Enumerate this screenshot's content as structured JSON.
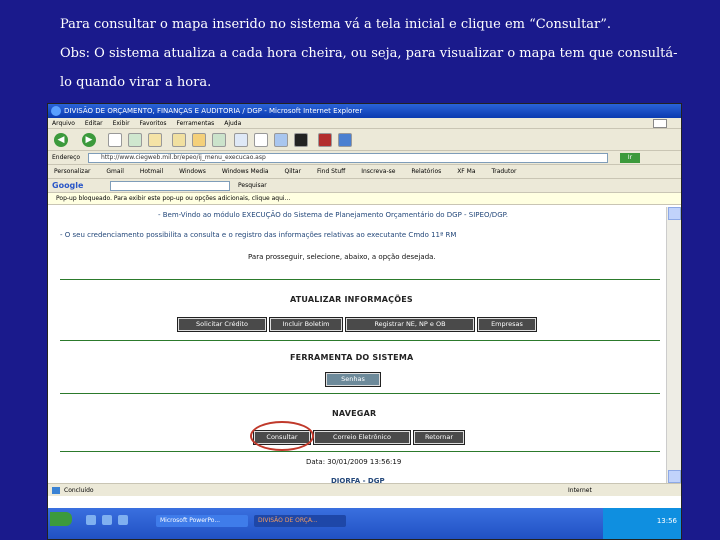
{
  "caption": {
    "line1": "Para consultar o mapa inserido no sistema vá a tela inicial e clique em “Consultar”.",
    "line2": "Obs: O sistema atualiza a cada hora cheira, ou seja, para visualizar o mapa tem que consultá-lo quando virar a hora."
  },
  "browser": {
    "title": "DIVISÃO DE ORÇAMENTO, FINANÇAS E AUDITORIA / DGP - Microsoft Internet Explorer",
    "menu": [
      "Arquivo",
      "Editar",
      "Exibir",
      "Favoritos",
      "Ferramentas",
      "Ajuda"
    ],
    "address_label": "Endereço",
    "address_value": "http://www.ciegweb.mil.br/epeo/ij_menu_execucao.asp",
    "go_label": "Ir",
    "links": [
      "Personalizar",
      "Gmail",
      "Hotmail",
      "Windows",
      "Windows Media",
      "Qiltar",
      "Find Stuff",
      "Inscreva-se",
      "Relatórios",
      "XF Ma",
      "Tradutor"
    ],
    "google_label": "Google",
    "google_search": "Pesquisar",
    "popup_notice": "Pop-up bloqueado. Para exibir este pop-up ou opções adicionais, clique aqui..."
  },
  "page": {
    "welcome": "- Bem-Vindo ao módulo EXECUÇÃO do Sistema de Planejamento Orçamentário do DGP - SIPEO/DGP.",
    "note": "- O seu credenciamento possibilita a consulta e o registro das informações relativas ao executante Cmdo 11ª RM",
    "prompt": "Para prosseguir, selecione, abaixo, a opção desejada.",
    "sections": {
      "atualizar": {
        "title": "ATUALIZAR INFORMAÇÕES",
        "buttons": [
          "Solicitar Crédito",
          "Incluir Boletim",
          "Registrar NE, NP e OB",
          "Empresas"
        ]
      },
      "ferramenta": {
        "title": "FERRAMENTA DO SISTEMA",
        "buttons": [
          "Senhas"
        ]
      },
      "navegar": {
        "title": "NAVEGAR",
        "buttons": [
          "Consultar",
          "Correio Eletrônico",
          "Retornar"
        ]
      }
    },
    "date": "Data: 30/01/2009 13:56:19",
    "footer": "DIORFA - DGP"
  },
  "statusbar": {
    "done": "Concluído",
    "zone": "Internet"
  },
  "taskbar": {
    "tasks": [
      "Microsoft PowerPo...",
      "DIVISÃO DE ORÇA..."
    ],
    "clock": "13:56"
  },
  "colors": {
    "slide_bg": "#1a1a8c",
    "highlight": "#c0392b",
    "section_rule": "#2c7a2c"
  }
}
